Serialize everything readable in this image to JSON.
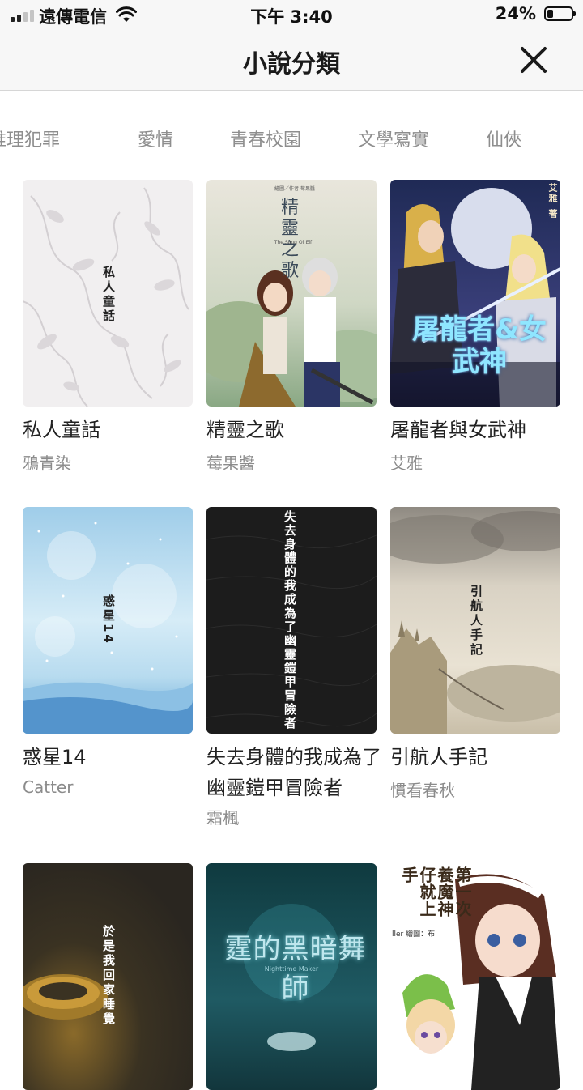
{
  "status_bar": {
    "carrier": "遠傳電信",
    "time": "下午 3:40",
    "battery_pct": "24%",
    "battery_level": 0.24,
    "signal_bars_active": 2
  },
  "header": {
    "title": "小說分類",
    "close_icon": "close-icon"
  },
  "tabs": [
    "推理犯罪",
    "愛情",
    "青春校園",
    "文學寫實",
    "仙俠"
  ],
  "books": [
    {
      "title": "私人童話",
      "author": "鴉青染",
      "cover_text": "私人童話"
    },
    {
      "title": "精靈之歌",
      "author": "莓果醬",
      "cover_text": "精靈之歌",
      "cover_small": "The Song Of Elf",
      "cover_credit": "繪圖／作者 莓果醬"
    },
    {
      "title": "屠龍者與女武神",
      "author": "艾雅",
      "cover_text": "屠龍者&女武神",
      "cover_credit": "艾雅 著"
    },
    {
      "title": "惑星14",
      "author": "Catter",
      "cover_text": "惑星14"
    },
    {
      "title": "失去身體的我成為了幽靈鎧甲冒險者",
      "author": "霜楓",
      "cover_text": "失去身體的我成為了幽靈鎧甲冒險者"
    },
    {
      "title": "引航人手記",
      "author": "慣看春秋",
      "cover_text": "引航人手記"
    },
    {
      "title": "",
      "author": "",
      "cover_text": "於是我回家睡覺"
    },
    {
      "title": "",
      "author": "",
      "cover_text": "霆的黑暗舞師",
      "cover_small": "Nighttime Maker"
    },
    {
      "title": "",
      "author": "",
      "cover_text": "第一次養魔神仔就上手",
      "cover_credit": "ller 繪圖：布"
    }
  ],
  "colors": {
    "accent_text": "#222222",
    "muted_text": "#8b8b8b",
    "bar_bg": "#f7f7f7"
  }
}
